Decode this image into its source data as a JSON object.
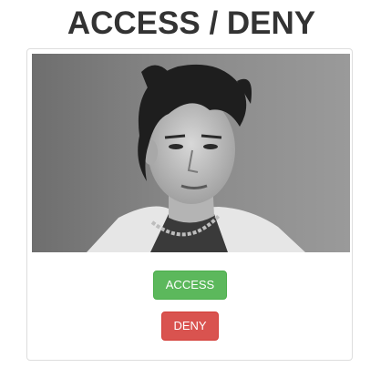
{
  "header": {
    "title": "ACCESS / DENY"
  },
  "card": {
    "photo": {
      "subject": "grayscale portrait photo"
    },
    "buttons": {
      "access_label": "ACCESS",
      "deny_label": "DENY"
    }
  },
  "colors": {
    "access": "#5cb85c",
    "deny": "#d9534f",
    "title": "#333333"
  }
}
